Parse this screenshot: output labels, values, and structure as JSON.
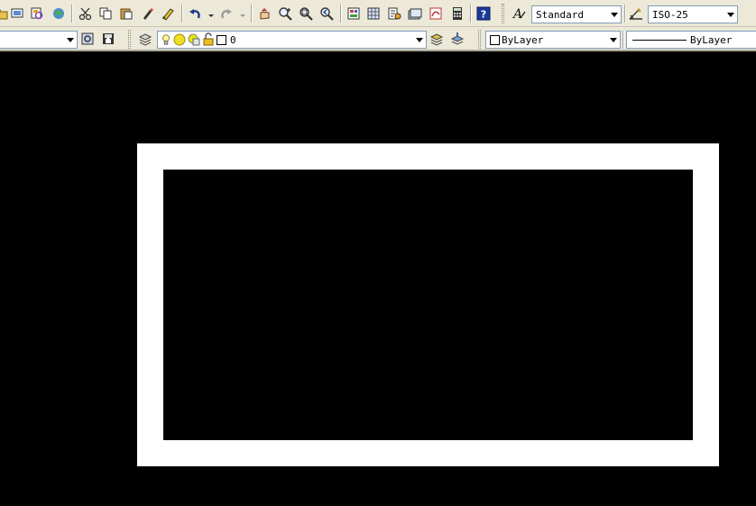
{
  "toolbar": {
    "text_style": "Standard",
    "dim_style": "ISO-25"
  },
  "layers": {
    "current": "0",
    "color": "ByLayer",
    "linetype": "ByLayer"
  },
  "colors": {
    "canvas_bg": "#000000",
    "outer_rect": "#ffffff",
    "inner_rect": "#000000"
  }
}
